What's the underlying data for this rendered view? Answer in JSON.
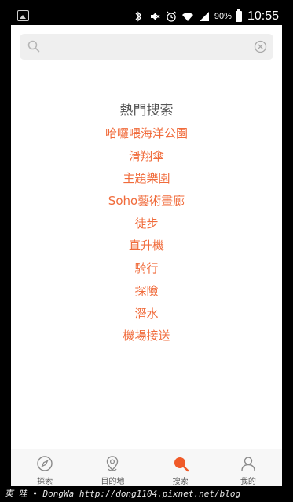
{
  "status_bar": {
    "battery_percent": "90%",
    "time": "10:55",
    "icons": [
      "gallery-icon",
      "bluetooth-icon",
      "mute-icon",
      "alarm-icon",
      "wifi-icon",
      "signal-icon",
      "battery-icon"
    ]
  },
  "search": {
    "placeholder": "",
    "value": ""
  },
  "hot_search": {
    "title": "熱門搜索",
    "items": [
      "哈囉喂海洋公園",
      "滑翔傘",
      "主題樂園",
      "Soho藝術畫廊",
      "徒步",
      "直升機",
      "騎行",
      "探險",
      "潛水",
      "機場接送"
    ]
  },
  "tabs": [
    {
      "label": "探索",
      "icon": "compass-icon",
      "active": false
    },
    {
      "label": "目的地",
      "icon": "location-pin-icon",
      "active": false
    },
    {
      "label": "搜索",
      "icon": "search-icon",
      "active": true
    },
    {
      "label": "我的",
      "icon": "user-icon",
      "active": false
    }
  ],
  "colors": {
    "accent": "#f06b3b",
    "tab_active": "#f05a28",
    "tab_inactive": "#8a8a8a"
  },
  "watermark": "東 哇 • DongWa http://dong1104.pixnet.net/blog"
}
